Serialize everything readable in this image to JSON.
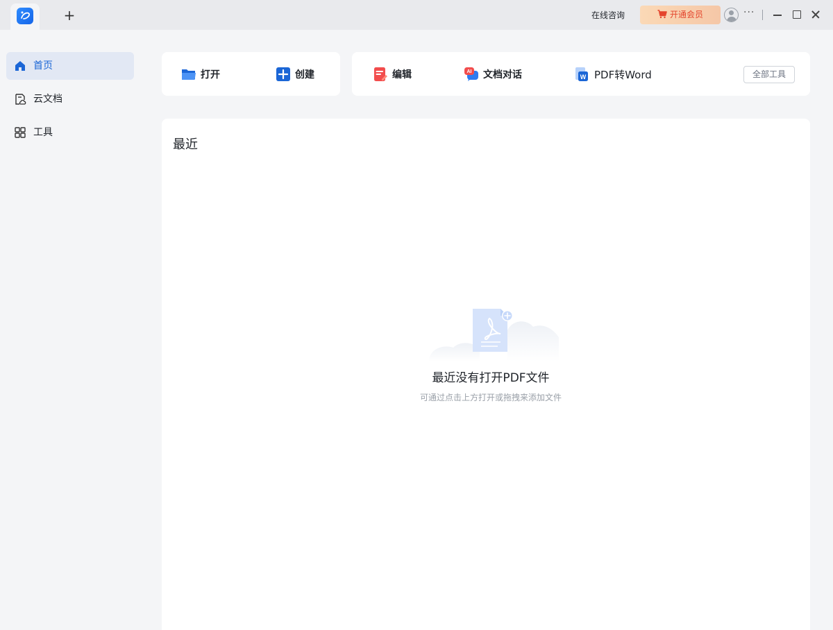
{
  "titlebar": {
    "new_tab_label": "+",
    "consult_label": "在线咨询",
    "vip_label": "开通会员",
    "more_label": "···"
  },
  "sidebar": {
    "items": [
      {
        "label": "首页",
        "icon": "home-icon",
        "active": true
      },
      {
        "label": "云文档",
        "icon": "cloud-doc-icon",
        "active": false
      },
      {
        "label": "工具",
        "icon": "grid-icon",
        "active": false
      }
    ]
  },
  "toolbar": {
    "open_label": "打开",
    "create_label": "创建",
    "edit_label": "编辑",
    "ai_chat_label": "文档对话",
    "pdf_to_word_label": "PDF转Word",
    "all_tools_label": "全部工具"
  },
  "recent": {
    "title": "最近",
    "empty_title": "最近没有打开PDF文件",
    "empty_subtitle": "可通过点击上方打开或拖拽来添加文件"
  },
  "colors": {
    "accent": "#1b66d6",
    "vip_text": "#e4452d",
    "background": "#f4f5f7"
  }
}
